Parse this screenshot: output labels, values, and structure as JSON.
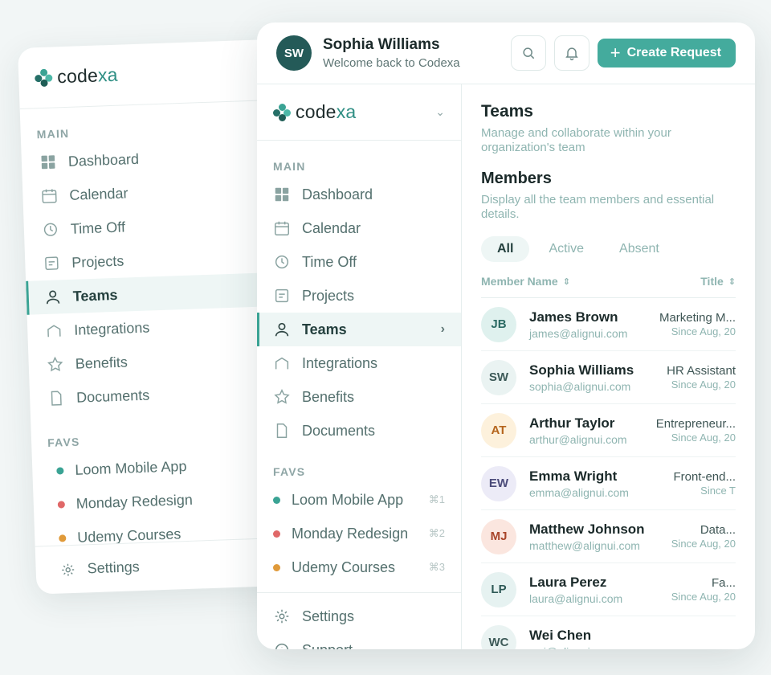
{
  "brand": {
    "logo_left": "code",
    "logo_right": "xa"
  },
  "back_sidebar": {
    "main_label": "MAIN",
    "items": [
      {
        "label": "Dashboard"
      },
      {
        "label": "Calendar"
      },
      {
        "label": "Time Off"
      },
      {
        "label": "Projects"
      },
      {
        "label": "Teams"
      },
      {
        "label": "Integrations"
      },
      {
        "label": "Benefits"
      },
      {
        "label": "Documents"
      }
    ],
    "favs_label": "FAVS",
    "favs": [
      {
        "label": "Loom Mobile App",
        "color": "#3aa394"
      },
      {
        "label": "Monday Redesign",
        "color": "#e06868"
      },
      {
        "label": "Udemy Courses",
        "color": "#e09a3a"
      }
    ],
    "settings_label": "Settings"
  },
  "header": {
    "avatar_initials": "SW",
    "user_name": "Sophia Williams",
    "welcome": "Welcome back to Codexa",
    "create_label": "Create Request"
  },
  "sidebar": {
    "main_label": "MAIN",
    "items": [
      {
        "label": "Dashboard"
      },
      {
        "label": "Calendar"
      },
      {
        "label": "Time Off"
      },
      {
        "label": "Projects"
      },
      {
        "label": "Teams",
        "arrow": "›"
      },
      {
        "label": "Integrations"
      },
      {
        "label": "Benefits"
      },
      {
        "label": "Documents"
      }
    ],
    "favs_label": "FAVS",
    "favs": [
      {
        "label": "Loom Mobile App",
        "shortcut": "⌘1",
        "color": "#3aa394"
      },
      {
        "label": "Monday Redesign",
        "shortcut": "⌘2",
        "color": "#e06868"
      },
      {
        "label": "Udemy Courses",
        "shortcut": "⌘3",
        "color": "#e09a3a"
      }
    ],
    "settings_label": "Settings",
    "support_label": "Support"
  },
  "main": {
    "title": "Teams",
    "subtitle": "Manage and collaborate within your organization's team",
    "members_title": "Members",
    "members_sub": "Display all the team members and essential details.",
    "tabs": [
      {
        "label": "All"
      },
      {
        "label": "Active"
      },
      {
        "label": "Absent"
      }
    ],
    "col_name": "Member Name",
    "col_title": "Title",
    "members": [
      {
        "initials": "JB",
        "name": "James Brown",
        "email": "james@alignui.com",
        "title": "Marketing M...",
        "since": "Since Aug, 20",
        "bg": "#dff1ee",
        "fg": "#2b6b64"
      },
      {
        "initials": "SW",
        "name": "Sophia Williams",
        "email": "sophia@alignui.com",
        "title": "HR Assistant",
        "since": "Since Aug, 20",
        "bg": "#eaf3f2",
        "fg": "#3d5a58"
      },
      {
        "initials": "AT",
        "name": "Arthur Taylor",
        "email": "arthur@alignui.com",
        "title": "Entrepreneur...",
        "since": "Since Aug, 20",
        "bg": "#fdf1dc",
        "fg": "#b5651d"
      },
      {
        "initials": "EW",
        "name": "Emma Wright",
        "email": "emma@alignui.com",
        "title": "Front-end...",
        "since": "Since T",
        "bg": "#ecebf7",
        "fg": "#4b4b7a"
      },
      {
        "initials": "MJ",
        "name": "Matthew Johnson",
        "email": "matthew@alignui.com",
        "title": "Data...",
        "since": "Since Aug, 20",
        "bg": "#fbe6df",
        "fg": "#a9452a"
      },
      {
        "initials": "LP",
        "name": "Laura Perez",
        "email": "laura@alignui.com",
        "title": "Fa...",
        "since": "Since Aug, 20",
        "bg": "#e6f2f1",
        "fg": "#2e5956"
      },
      {
        "initials": "WC",
        "name": "Wei Chen",
        "email": "wei@alignui.com",
        "title": "",
        "since": "",
        "bg": "#eaf3f2",
        "fg": "#3d5a58"
      }
    ]
  }
}
